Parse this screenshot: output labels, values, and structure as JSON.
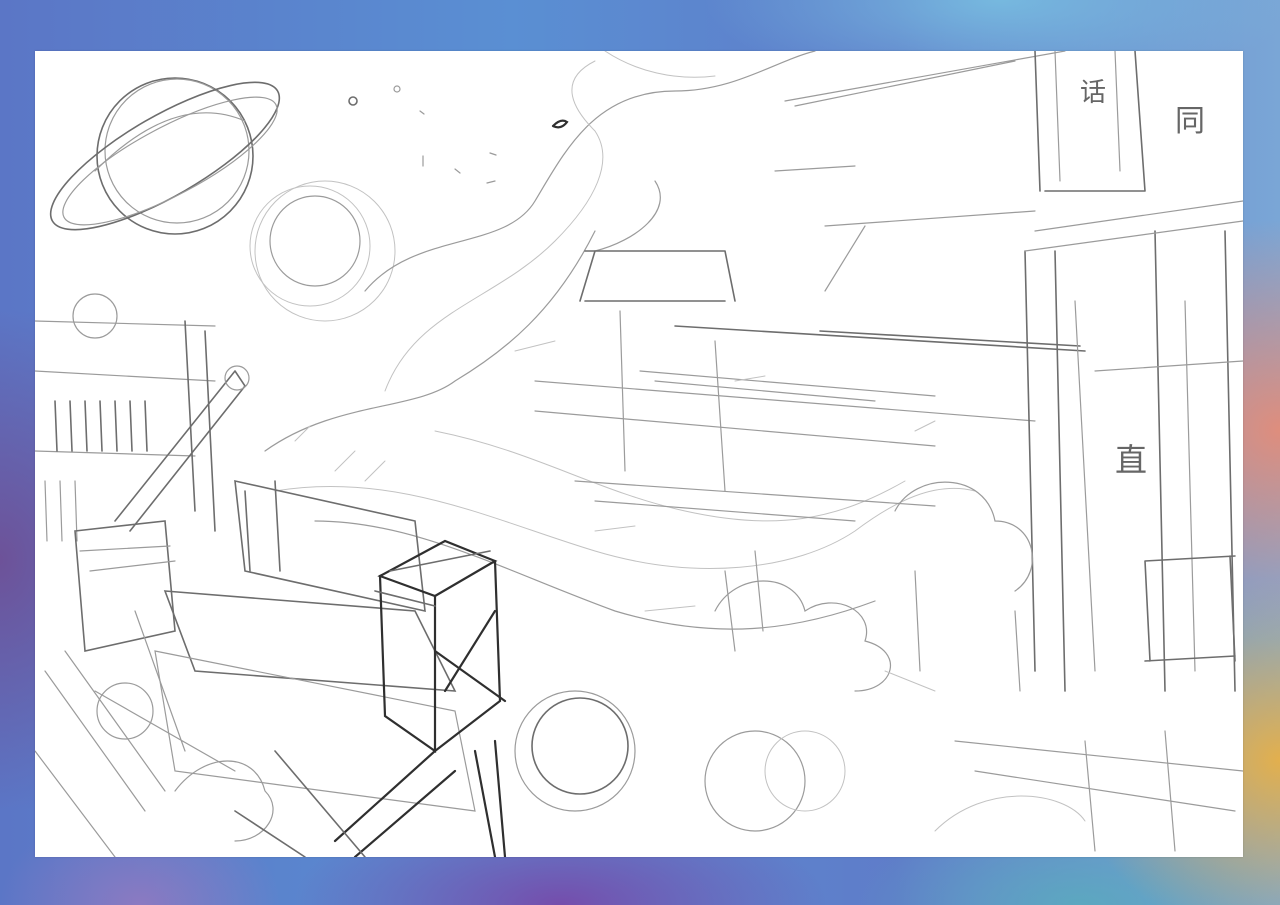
{
  "frame": {
    "colors": [
      "#5b76c6",
      "#6e5096",
      "#e48c78",
      "#e8b046",
      "#764aaa",
      "#5aaabe",
      "#78bee1"
    ]
  },
  "canvas": {
    "background": "#ffffff",
    "stroke_colors": [
      "#2f2f2f",
      "#6d6d6d",
      "#9b9b9b",
      "#c2c2c2"
    ]
  }
}
